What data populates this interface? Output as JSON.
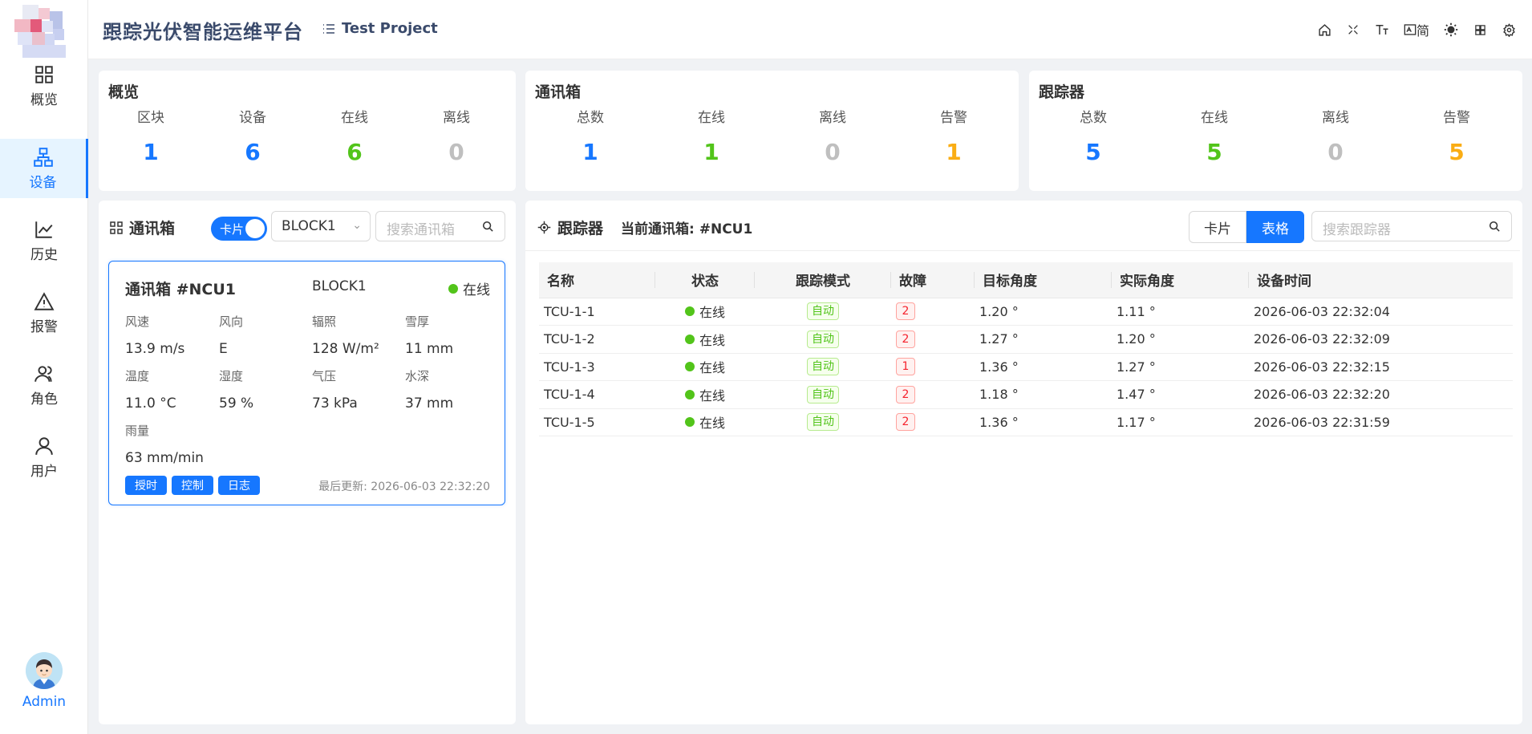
{
  "header": {
    "app_title": "跟踪光伏智能运维平台",
    "project": "Test Project",
    "lang_label": "简"
  },
  "sidebar": {
    "items": [
      {
        "label": "概览",
        "icon": "grid-icon"
      },
      {
        "label": "设备",
        "icon": "network-icon"
      },
      {
        "label": "历史",
        "icon": "chart-line-icon"
      },
      {
        "label": "报警",
        "icon": "warning-icon"
      },
      {
        "label": "角色",
        "icon": "users-icon"
      },
      {
        "label": "用户",
        "icon": "user-icon"
      }
    ],
    "user_name": "Admin"
  },
  "overview": {
    "title": "概览",
    "stats": [
      {
        "label": "区块",
        "value": "1",
        "color": "#1677ff"
      },
      {
        "label": "设备",
        "value": "6",
        "color": "#1677ff"
      },
      {
        "label": "在线",
        "value": "6",
        "color": "#52c41a"
      },
      {
        "label": "离线",
        "value": "0",
        "color": "#bfbfbf"
      }
    ]
  },
  "ncu_stats": {
    "title": "通讯箱",
    "stats": [
      {
        "label": "总数",
        "value": "1",
        "color": "#1677ff"
      },
      {
        "label": "在线",
        "value": "1",
        "color": "#52c41a"
      },
      {
        "label": "离线",
        "value": "0",
        "color": "#bfbfbf"
      },
      {
        "label": "告警",
        "value": "1",
        "color": "#faad14"
      }
    ]
  },
  "tracker_stats": {
    "title": "跟踪器",
    "stats": [
      {
        "label": "总数",
        "value": "5",
        "color": "#1677ff"
      },
      {
        "label": "在线",
        "value": "5",
        "color": "#52c41a"
      },
      {
        "label": "离线",
        "value": "0",
        "color": "#bfbfbf"
      },
      {
        "label": "告警",
        "value": "5",
        "color": "#faad14"
      }
    ]
  },
  "ncu_panel": {
    "title": "通讯箱",
    "toggle_label": "卡片",
    "block_select": "BLOCK1",
    "search_placeholder": "搜索通讯箱",
    "card": {
      "title": "通讯箱 #NCU1",
      "block": "BLOCK1",
      "status": "在线",
      "metrics": [
        {
          "label": "风速",
          "value": "13.9 m/s"
        },
        {
          "label": "风向",
          "value": "E"
        },
        {
          "label": "辐照",
          "value": "128 W/m²"
        },
        {
          "label": "雪厚",
          "value": "11 mm"
        },
        {
          "label": "温度",
          "value": "11.0 °C"
        },
        {
          "label": "湿度",
          "value": "59 %"
        },
        {
          "label": "气压",
          "value": "73 kPa"
        },
        {
          "label": "水深",
          "value": "37 mm"
        },
        {
          "label": "雨量",
          "value": "63 mm/min"
        }
      ],
      "buttons": [
        "授时",
        "控制",
        "日志"
      ],
      "updated": "最后更新: 2026-06-03 22:32:20"
    }
  },
  "tracker_panel": {
    "title": "跟踪器",
    "current": "当前通讯箱: #NCU1",
    "view_card": "卡片",
    "view_table": "表格",
    "search_placeholder": "搜索跟踪器",
    "columns": [
      "名称",
      "状态",
      "跟踪模式",
      "故障",
      "目标角度",
      "实际角度",
      "设备时间"
    ],
    "rows": [
      {
        "name": "TCU-1-1",
        "status": "在线",
        "mode": "自动",
        "fault": "2",
        "target": "1.20 °",
        "actual": "1.11 °",
        "time": "2026-06-03 22:32:04"
      },
      {
        "name": "TCU-1-2",
        "status": "在线",
        "mode": "自动",
        "fault": "2",
        "target": "1.27 °",
        "actual": "1.20 °",
        "time": "2026-06-03 22:32:09"
      },
      {
        "name": "TCU-1-3",
        "status": "在线",
        "mode": "自动",
        "fault": "1",
        "target": "1.36 °",
        "actual": "1.27 °",
        "time": "2026-06-03 22:32:15"
      },
      {
        "name": "TCU-1-4",
        "status": "在线",
        "mode": "自动",
        "fault": "2",
        "target": "1.18 °",
        "actual": "1.47 °",
        "time": "2026-06-03 22:32:20"
      },
      {
        "name": "TCU-1-5",
        "status": "在线",
        "mode": "自动",
        "fault": "2",
        "target": "1.36 °",
        "actual": "1.17 °",
        "time": "2026-06-03 22:31:59"
      }
    ]
  }
}
